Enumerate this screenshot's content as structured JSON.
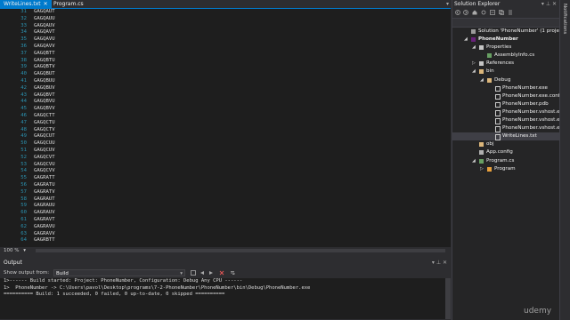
{
  "tabs": [
    {
      "label": "WriteLines.txt",
      "active": true
    },
    {
      "label": "Program.cs",
      "active": false
    }
  ],
  "editor": {
    "lines": [
      {
        "n": "31",
        "text": "GAGQAUT"
      },
      {
        "n": "32",
        "text": "GAGQAUU"
      },
      {
        "n": "33",
        "text": "GAGQAUV"
      },
      {
        "n": "34",
        "text": "GAGQAVT"
      },
      {
        "n": "35",
        "text": "GAGQAVU"
      },
      {
        "n": "36",
        "text": "GAGQAVV"
      },
      {
        "n": "37",
        "text": "GAGQBTT"
      },
      {
        "n": "38",
        "text": "GAGQBTU"
      },
      {
        "n": "39",
        "text": "GAGQBTV"
      },
      {
        "n": "40",
        "text": "GAGQBUT"
      },
      {
        "n": "41",
        "text": "GAGQBUU"
      },
      {
        "n": "42",
        "text": "GAGQBUV"
      },
      {
        "n": "43",
        "text": "GAGQBVT"
      },
      {
        "n": "44",
        "text": "GAGQBVU"
      },
      {
        "n": "45",
        "text": "GAGQBVV"
      },
      {
        "n": "46",
        "text": "GAGQCTT"
      },
      {
        "n": "47",
        "text": "GAGQCTU"
      },
      {
        "n": "48",
        "text": "GAGQCTV"
      },
      {
        "n": "49",
        "text": "GAGQCUT"
      },
      {
        "n": "50",
        "text": "GAGQCUU"
      },
      {
        "n": "51",
        "text": "GAGQCUV"
      },
      {
        "n": "52",
        "text": "GAGQCVT"
      },
      {
        "n": "53",
        "text": "GAGQCVU"
      },
      {
        "n": "54",
        "text": "GAGQCVV"
      },
      {
        "n": "55",
        "text": "GAGRATT"
      },
      {
        "n": "56",
        "text": "GAGRATU"
      },
      {
        "n": "57",
        "text": "GAGRATV"
      },
      {
        "n": "58",
        "text": "GAGRAUT"
      },
      {
        "n": "59",
        "text": "GAGRAUU"
      },
      {
        "n": "60",
        "text": "GAGRAUV"
      },
      {
        "n": "61",
        "text": "GAGRAVT"
      },
      {
        "n": "62",
        "text": "GAGRAVU"
      },
      {
        "n": "63",
        "text": "GAGRAVV"
      },
      {
        "n": "64",
        "text": "GAGRBTT"
      }
    ],
    "zoom": "100 %"
  },
  "output": {
    "title": "Output",
    "show_output_from": "Show output from:",
    "source": "Build",
    "lines": [
      "1>------ Build started: Project: PhoneNumber, Configuration: Debug Any CPU ------",
      "1>  PhoneNumber -> C:\\Users\\pavol\\Desktop\\programs\\7-2-PhoneNumber\\PhoneNumber\\bin\\Debug\\PhoneNumber.exe",
      "========== Build: 1 succeeded, 0 failed, 0 up-to-date, 0 skipped =========="
    ]
  },
  "solution_explorer": {
    "title": "Solution Explorer",
    "nodes": [
      {
        "label": "Solution 'PhoneNumber' (1 project)",
        "level": 0,
        "exp": "",
        "icon": "solution-icon",
        "bold": false,
        "sel": false
      },
      {
        "label": "PhoneNumber",
        "level": 0,
        "exp": "◢",
        "icon": "csharp-project-icon",
        "bold": true,
        "sel": false
      },
      {
        "label": "Properties",
        "level": 1,
        "exp": "◢",
        "icon": "wrench-icon",
        "bold": false,
        "sel": false
      },
      {
        "label": "AssemblyInfo.cs",
        "level": 2,
        "exp": "",
        "icon": "csharp-file-icon",
        "bold": false,
        "sel": false
      },
      {
        "label": "References",
        "level": 1,
        "exp": "▷",
        "icon": "references-icon",
        "bold": false,
        "sel": false
      },
      {
        "label": "bin",
        "level": 1,
        "exp": "◢",
        "icon": "folder-icon",
        "bold": false,
        "sel": false
      },
      {
        "label": "Debug",
        "level": 2,
        "exp": "◢",
        "icon": "folder-icon",
        "bold": false,
        "sel": false
      },
      {
        "label": "PhoneNumber.exe",
        "level": 3,
        "exp": "",
        "icon": "file-icon",
        "bold": false,
        "sel": false
      },
      {
        "label": "PhoneNumber.exe.conf",
        "level": 3,
        "exp": "",
        "icon": "file-icon",
        "bold": false,
        "sel": false
      },
      {
        "label": "PhoneNumber.pdb",
        "level": 3,
        "exp": "",
        "icon": "file-icon",
        "bold": false,
        "sel": false
      },
      {
        "label": "PhoneNumber.vshost.e",
        "level": 3,
        "exp": "",
        "icon": "file-icon",
        "bold": false,
        "sel": false
      },
      {
        "label": "PhoneNumber.vshost.e",
        "level": 3,
        "exp": "",
        "icon": "file-icon",
        "bold": false,
        "sel": false
      },
      {
        "label": "PhoneNumber.vshost.e",
        "level": 3,
        "exp": "",
        "icon": "file-icon",
        "bold": false,
        "sel": false
      },
      {
        "label": "WriteLines.txt",
        "level": 3,
        "exp": "",
        "icon": "file-icon",
        "bold": false,
        "sel": true
      },
      {
        "label": "obj",
        "level": 1,
        "exp": "",
        "icon": "folder-icon",
        "bold": false,
        "sel": false
      },
      {
        "label": "App.config",
        "level": 1,
        "exp": "",
        "icon": "config-file-icon",
        "bold": false,
        "sel": false
      },
      {
        "label": "Program.cs",
        "level": 1,
        "exp": "◢",
        "icon": "csharp-file-icon",
        "bold": false,
        "sel": false
      },
      {
        "label": "Program",
        "level": 2,
        "exp": "▷",
        "icon": "class-icon",
        "bold": false,
        "sel": false
      }
    ]
  },
  "notifications": {
    "label": "Notifications"
  },
  "watermark": "udemy",
  "colors": {
    "accent": "#007acc",
    "editor_bg": "#1e1e1e",
    "line_number": "#2b91af"
  }
}
